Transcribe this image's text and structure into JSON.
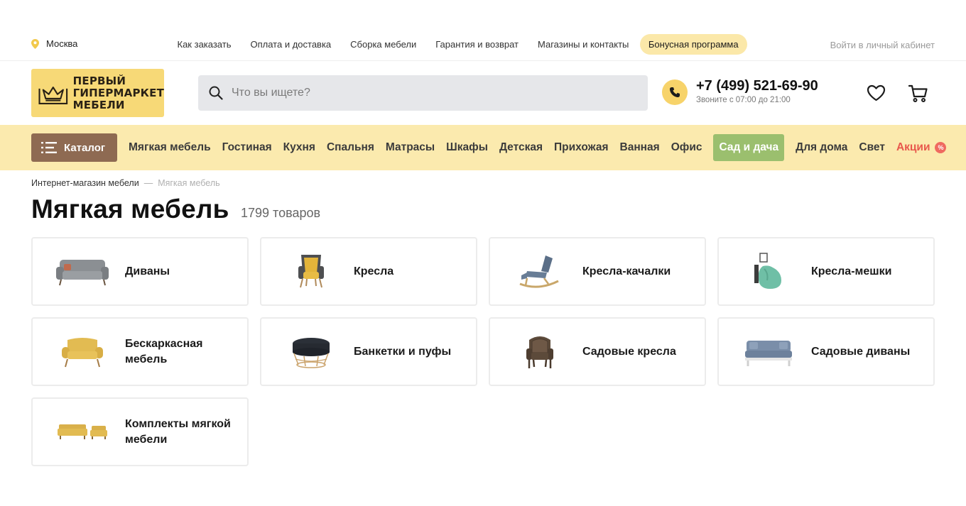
{
  "topbar": {
    "city": "Москва",
    "links": [
      {
        "label": "Как заказать"
      },
      {
        "label": "Оплата и доставка"
      },
      {
        "label": "Сборка мебели"
      },
      {
        "label": "Гарантия и возврат"
      },
      {
        "label": "Магазины и контакты"
      },
      {
        "label": "Бонусная программа"
      }
    ],
    "login": "Войти в личный кабинет"
  },
  "header": {
    "logo_lines": [
      "ПЕРВЫЙ",
      "ГИПЕРМАРКЕТ",
      "МЕБЕЛИ"
    ],
    "search_placeholder": "Что вы ищете?",
    "phone": "+7 (499) 521-69-90",
    "phone_hours": "Звоните с 07:00 до 21:00"
  },
  "catbar": {
    "catalog_label": "Каталог",
    "items": [
      {
        "label": "Мягкая мебель"
      },
      {
        "label": "Гостиная"
      },
      {
        "label": "Кухня"
      },
      {
        "label": "Спальня"
      },
      {
        "label": "Матрасы"
      },
      {
        "label": "Шкафы"
      },
      {
        "label": "Детская"
      },
      {
        "label": "Прихожая"
      },
      {
        "label": "Ванная"
      },
      {
        "label": "Офис"
      },
      {
        "label": "Сад и дача"
      },
      {
        "label": "Для дома"
      },
      {
        "label": "Свет"
      },
      {
        "label": "Акции"
      }
    ],
    "sale_badge": "%"
  },
  "breadcrumb": {
    "home": "Интернет-магазин мебели",
    "separator": "—",
    "current": "Мягкая мебель"
  },
  "page": {
    "title": "Мягкая мебель",
    "count": "1799 товаров"
  },
  "categories": [
    {
      "label": "Диваны"
    },
    {
      "label": "Кресла"
    },
    {
      "label": "Кресла-качалки"
    },
    {
      "label": "Кресла-мешки"
    },
    {
      "label": "Бескаркасная мебель"
    },
    {
      "label": "Банкетки и пуфы"
    },
    {
      "label": "Садовые кресла"
    },
    {
      "label": "Садовые диваны"
    },
    {
      "label": "Комплекты мягкой мебели"
    }
  ],
  "colors": {
    "accent_yellow": "#fbeaae",
    "logo_yellow": "#f7d977",
    "catalog_brown": "#8e6a52",
    "garden_green": "#9bbf6e",
    "sale_red": "#e8584c"
  }
}
